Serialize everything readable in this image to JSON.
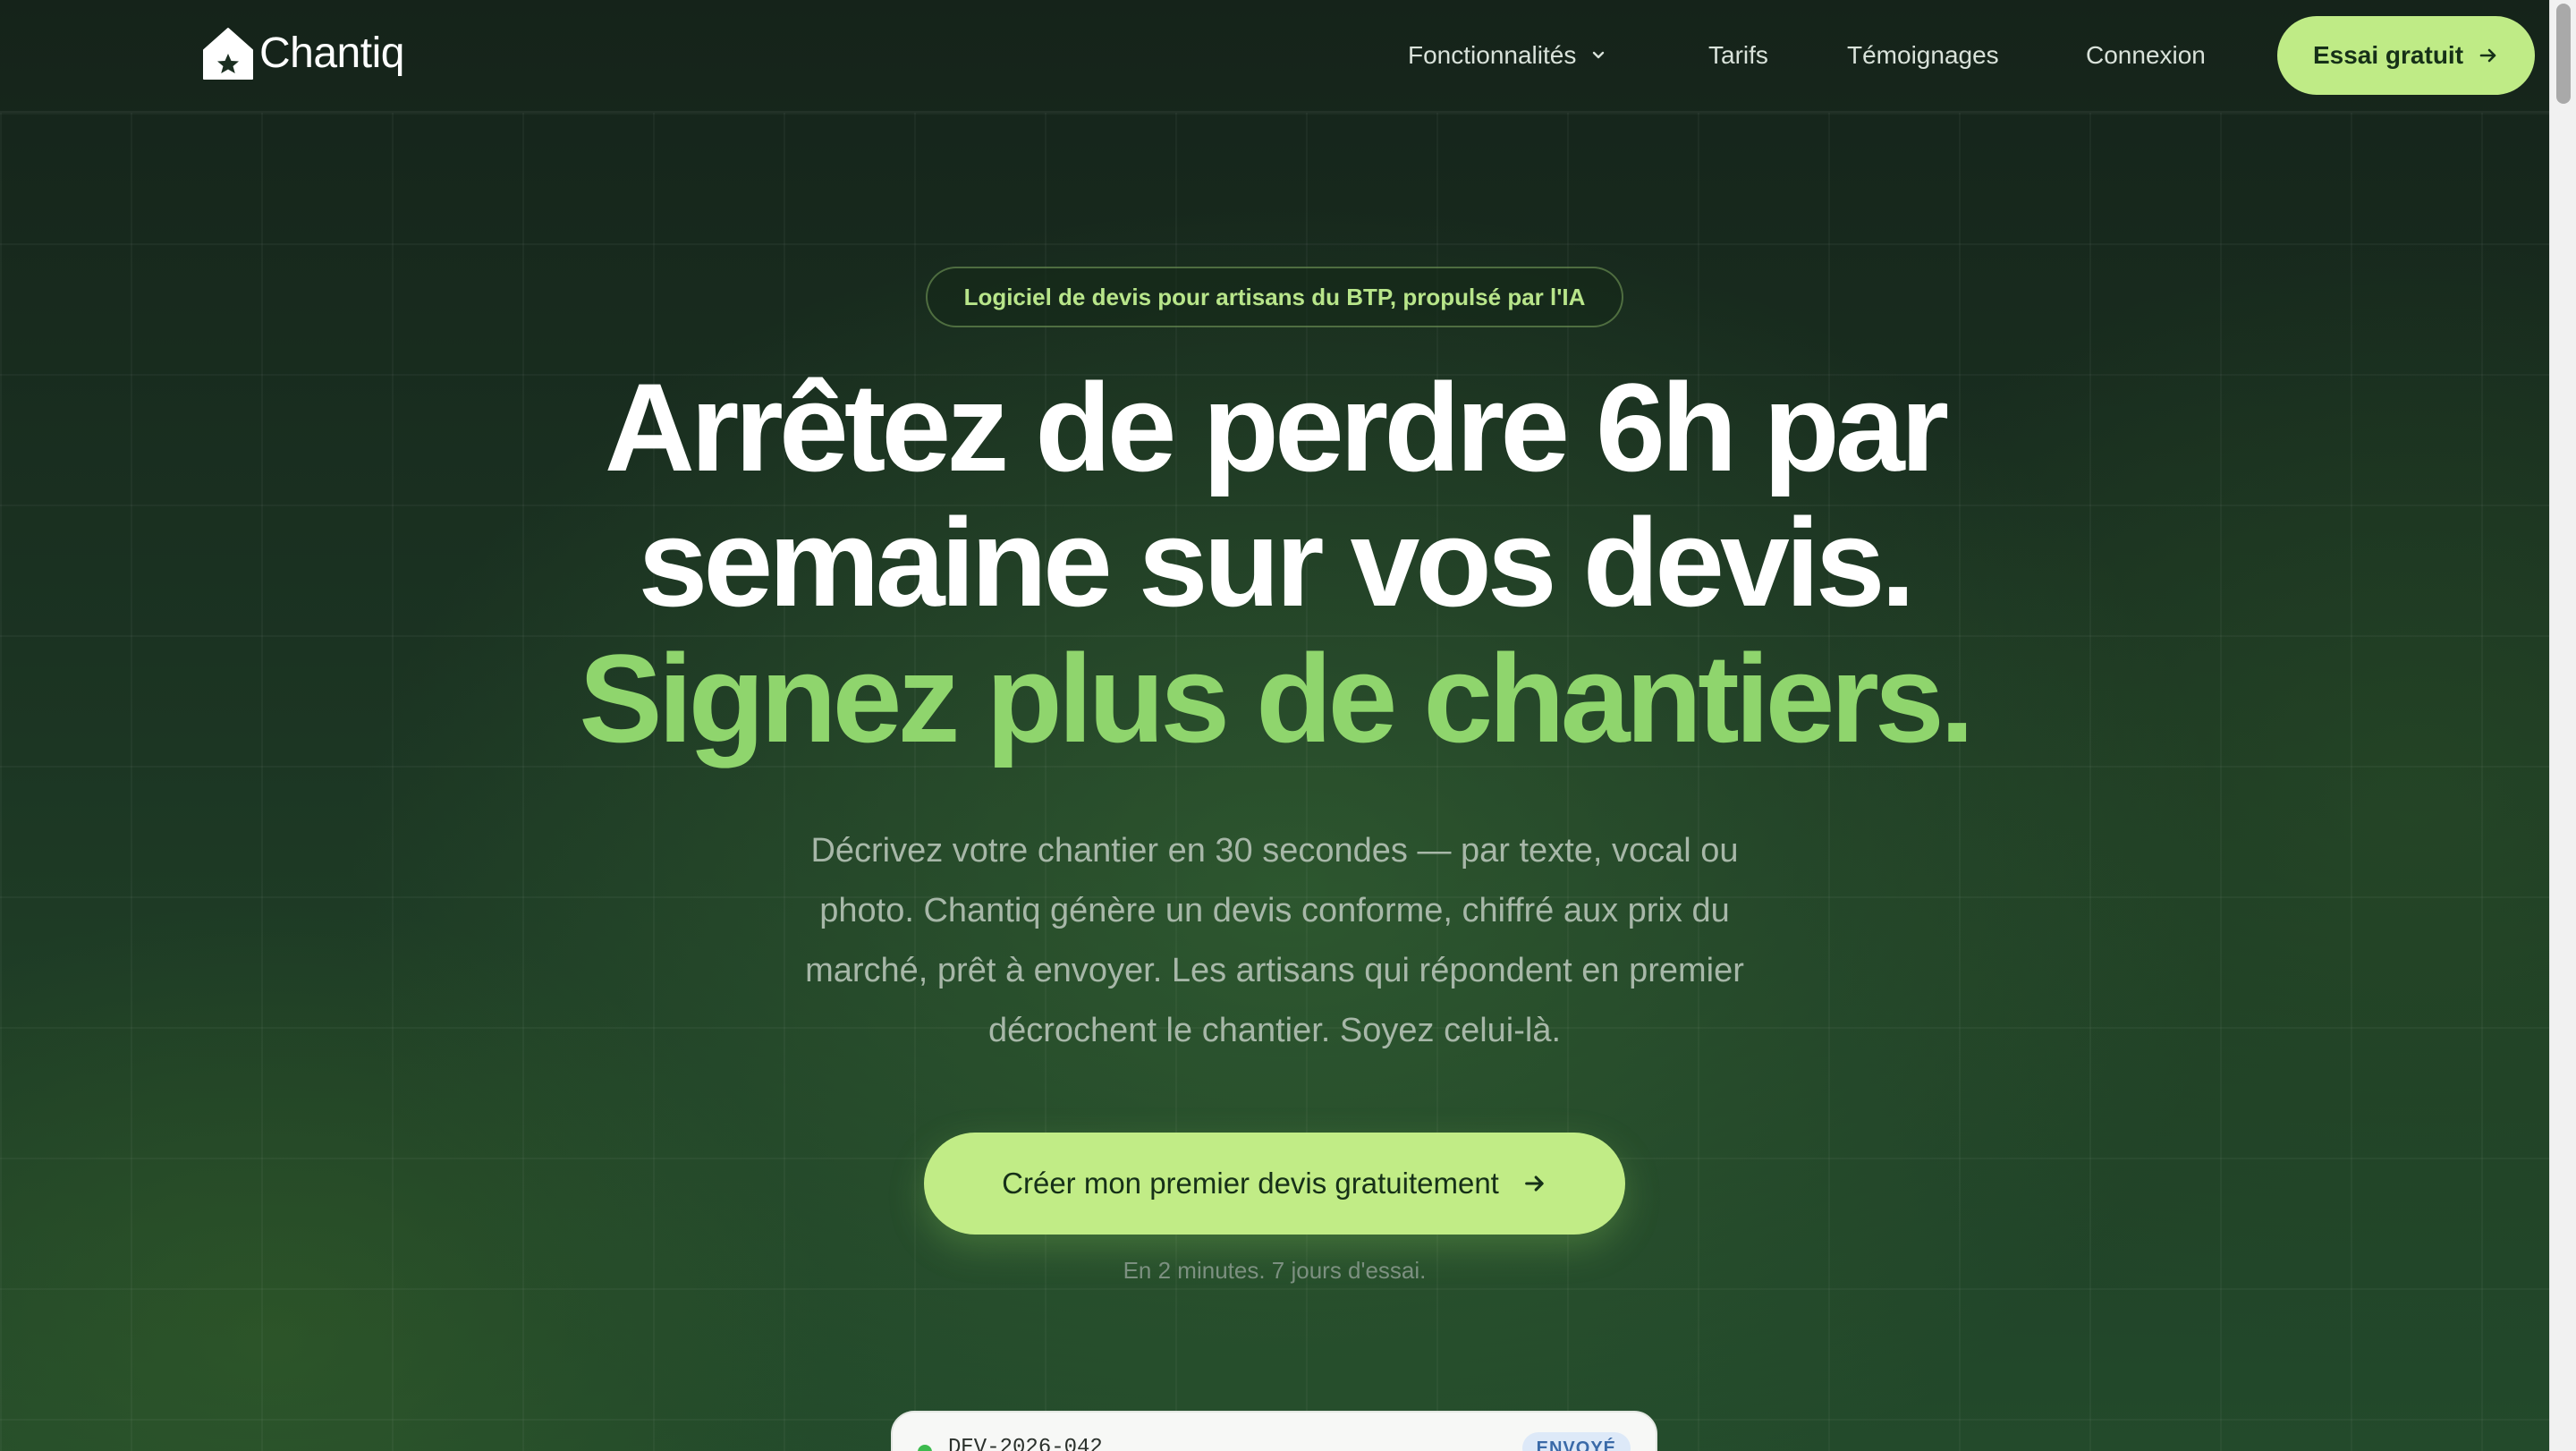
{
  "nav": {
    "brand": "Chantiq",
    "links": [
      {
        "label": "Fonctionnalités",
        "has_dropdown": true
      },
      {
        "label": "Tarifs"
      },
      {
        "label": "Témoignages"
      },
      {
        "label": "Connexion"
      }
    ],
    "cta_label": "Essai gratuit"
  },
  "hero": {
    "badge": "Logiciel de devis pour artisans du BTP, propulsé par l'IA",
    "headline_line1": "Arrêtez de perdre 6h par",
    "headline_line2": "semaine sur vos devis.",
    "headline_line3": "Signez plus de chantiers.",
    "subtext": "Décrivez votre chantier en 30 secondes — par texte, vocal ou photo. Chantiq génère un devis conforme, chiffré aux prix du marché, prêt à envoyer. Les artisans qui répondent en premier décrochent le chantier. Soyez celui-là.",
    "cta_label": "Créer mon premier devis gratuitement",
    "cta_note": "En 2 minutes. 7 jours d'essai."
  },
  "quote_preview": {
    "id": "DEV-2026-042",
    "status": "ENVOYÉ"
  },
  "colors": {
    "accent": "#bfeb86",
    "headline_green": "#8fd56d",
    "background": "#1b3322"
  },
  "icons": [
    "house-logo-icon",
    "chevron-down-icon",
    "arrow-right-icon"
  ]
}
